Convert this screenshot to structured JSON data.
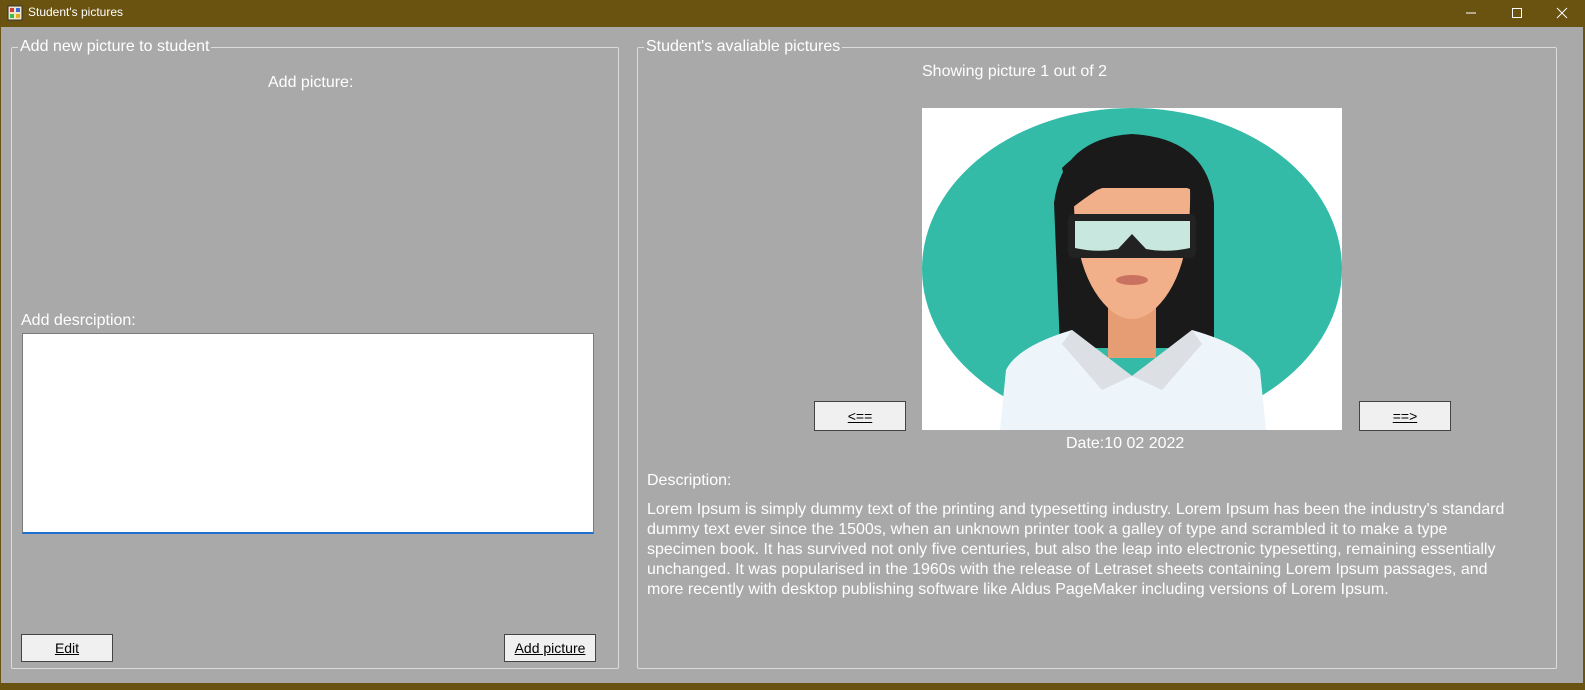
{
  "window": {
    "title": "Student's pictures"
  },
  "left_group": {
    "legend": "Add new picture to student",
    "add_picture_label": "Add picture:",
    "description_label": "Add desrciption:",
    "description_value": "",
    "edit_button": "Edit",
    "add_picture_button": "Add picture"
  },
  "right_group": {
    "legend": "Student's avaliable pictures",
    "showing_text": "Showing picture 1 out of 2",
    "prev_button": "<==",
    "next_button": "==>",
    "date_text": "Date:10 02 2022",
    "description_label": "Description:",
    "description_text": "Lorem Ipsum is simply dummy text of the printing and typesetting industry. Lorem Ipsum has been the industry's standard dummy text ever since the 1500s, when an unknown printer took a galley of type and scrambled it to make a type specimen book. It has survived not only five centuries, but also the leap into electronic typesetting, remaining essentially unchanged. It was popularised in the 1960s with the release of Letraset sheets containing Lorem Ipsum passages, and more recently with desktop publishing software like Aldus PageMaker including versions of Lorem Ipsum."
  },
  "colors": {
    "titlebar": "#6a5310",
    "client_background": "#a9a9a9",
    "avatar_background": "#33bba8",
    "focus_underline": "#1e6fd0"
  },
  "icons": {
    "app": "app-icon",
    "minimize": "minimize-icon",
    "maximize": "maximize-icon",
    "close": "close-icon",
    "picture": "student-avatar-image"
  }
}
